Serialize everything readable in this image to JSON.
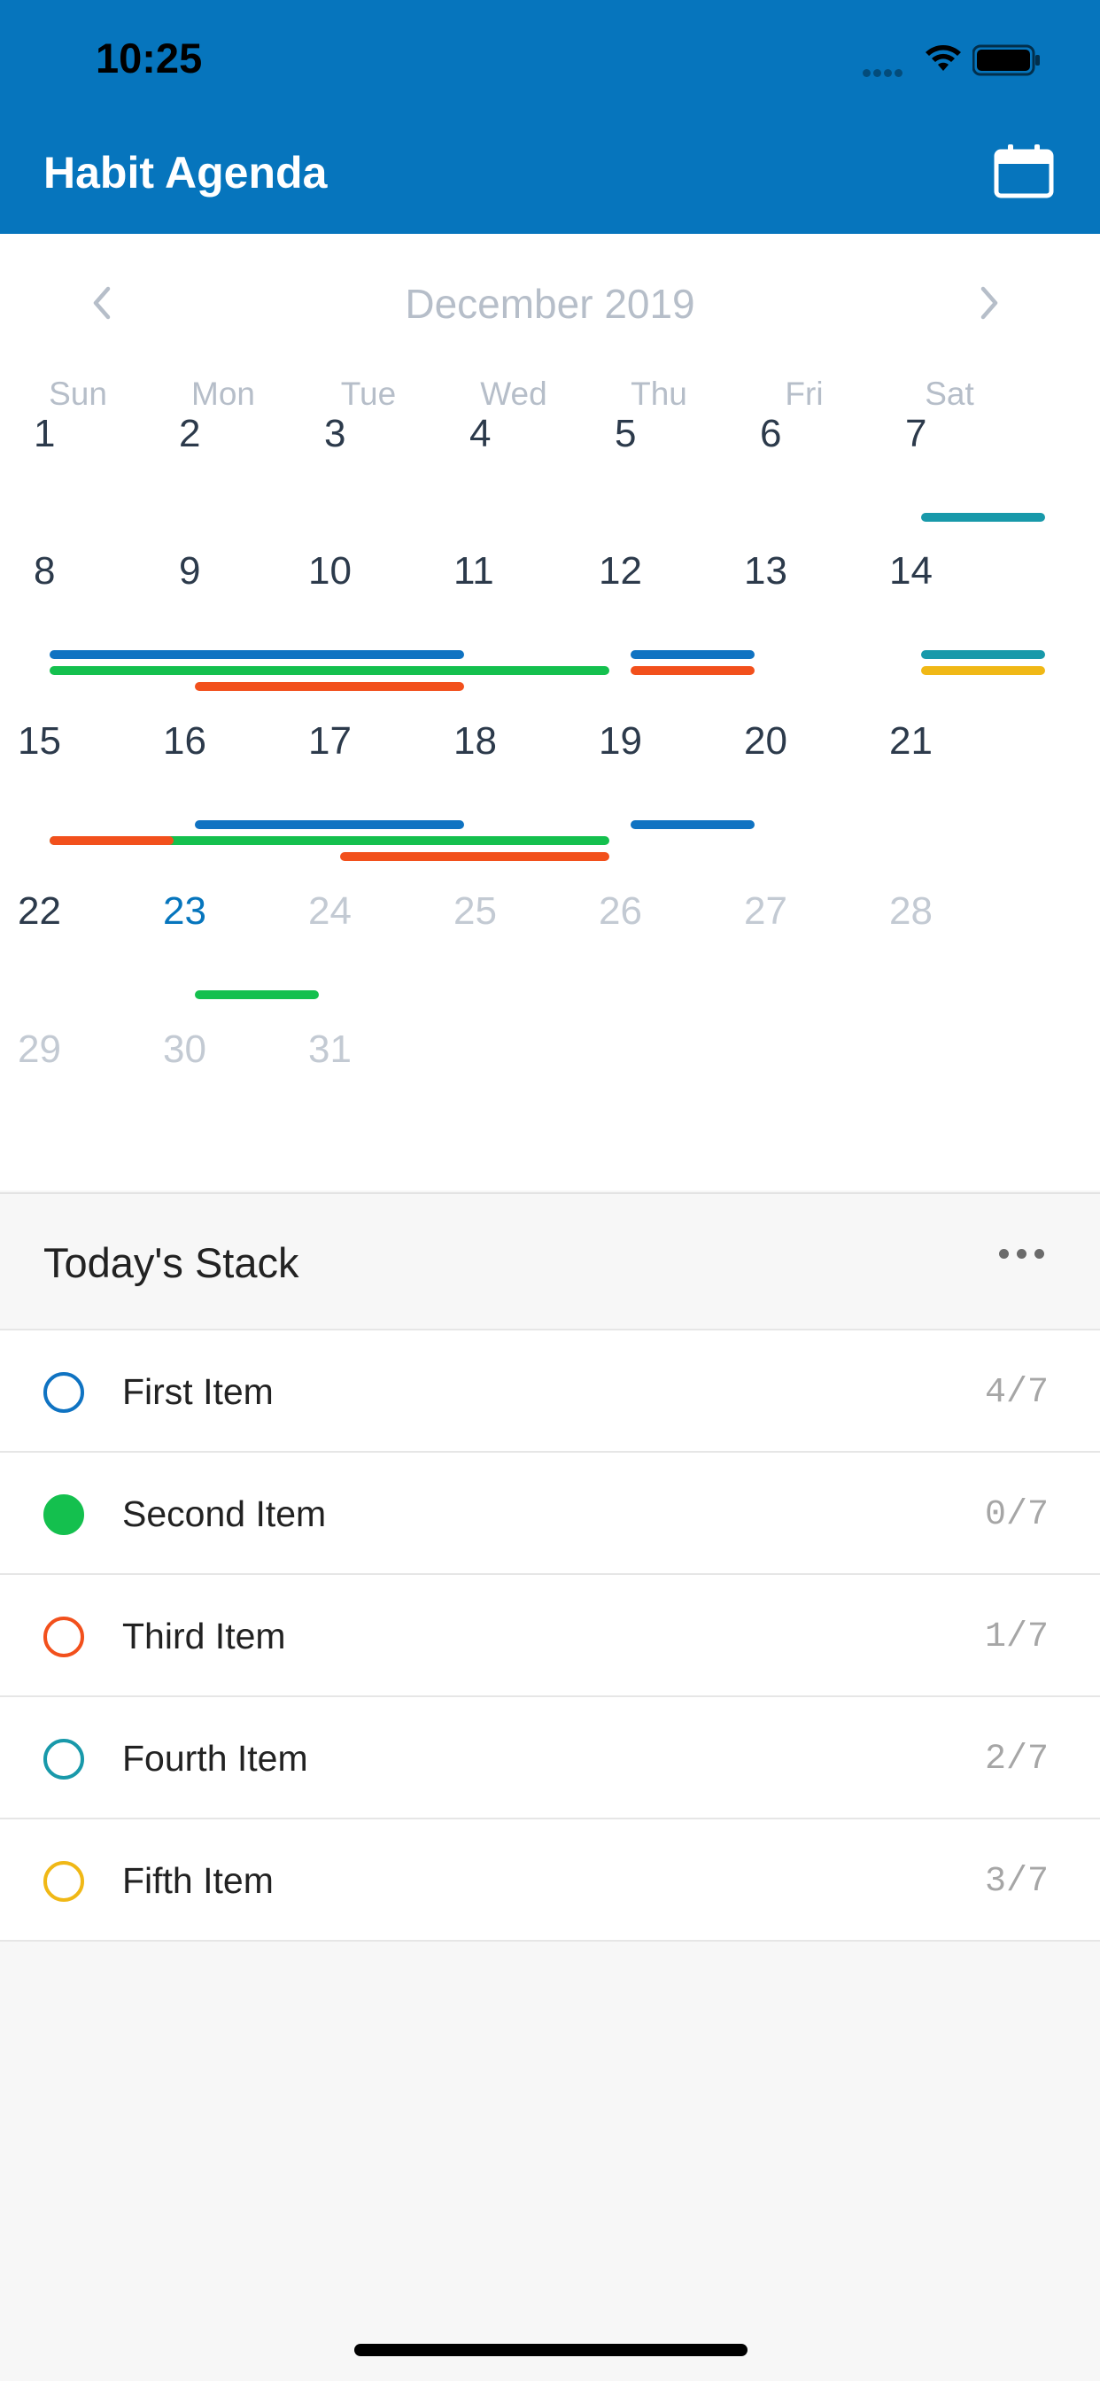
{
  "status_bar": {
    "time": "10:25",
    "icons": [
      "signal-icon",
      "wifi-icon",
      "battery-icon"
    ]
  },
  "app": {
    "title": "Habit Agenda",
    "header_color": "#0675bd",
    "calendar_icon": "calendar-icon"
  },
  "calendar": {
    "month_label": "December 2019",
    "prev_icon": "chevron-left-icon",
    "next_icon": "chevron-right-icon",
    "weekdays": [
      "Sun",
      "Mon",
      "Tue",
      "Wed",
      "Thu",
      "Fri",
      "Sat"
    ],
    "days": [
      {
        "label": "1",
        "state": "normal",
        "bars": []
      },
      {
        "label": "2",
        "state": "normal",
        "bars": []
      },
      {
        "label": "3",
        "state": "normal",
        "bars": []
      },
      {
        "label": "4",
        "state": "normal",
        "bars": []
      },
      {
        "label": "5",
        "state": "normal",
        "bars": []
      },
      {
        "label": "6",
        "state": "normal",
        "bars": []
      },
      {
        "label": "7",
        "state": "normal",
        "bars": [
          "teal"
        ]
      },
      {
        "label": "8",
        "state": "normal",
        "bars": [
          "blue",
          "green"
        ]
      },
      {
        "label": "9",
        "state": "normal",
        "bars": [
          "blue",
          "green",
          "orange"
        ]
      },
      {
        "label": "10",
        "state": "normal",
        "bars": [
          "blue",
          "green",
          "orange"
        ]
      },
      {
        "label": "11",
        "state": "normal",
        "bars": [
          "green"
        ]
      },
      {
        "label": "12",
        "state": "normal",
        "bars": [
          "blue",
          "orange"
        ]
      },
      {
        "label": "13",
        "state": "normal",
        "bars": []
      },
      {
        "label": "14",
        "state": "normal",
        "bars": [
          "teal",
          "yellow"
        ]
      },
      {
        "label": "15",
        "state": "normal",
        "bars": [
          "green",
          "orange"
        ]
      },
      {
        "label": "16",
        "state": "normal",
        "bars": [
          "blue",
          "green"
        ]
      },
      {
        "label": "17",
        "state": "normal",
        "bars": [
          "blue",
          "green",
          "orange"
        ]
      },
      {
        "label": "18",
        "state": "normal",
        "bars": [
          "green",
          "orange"
        ]
      },
      {
        "label": "19",
        "state": "normal",
        "bars": [
          "blue"
        ]
      },
      {
        "label": "20",
        "state": "normal",
        "bars": []
      },
      {
        "label": "21",
        "state": "normal",
        "bars": []
      },
      {
        "label": "22",
        "state": "normal",
        "bars": []
      },
      {
        "label": "23",
        "state": "today",
        "bars": [
          "green"
        ]
      },
      {
        "label": "24",
        "state": "inactive",
        "bars": []
      },
      {
        "label": "25",
        "state": "inactive",
        "bars": []
      },
      {
        "label": "26",
        "state": "inactive",
        "bars": []
      },
      {
        "label": "27",
        "state": "inactive",
        "bars": []
      },
      {
        "label": "28",
        "state": "inactive",
        "bars": []
      },
      {
        "label": "29",
        "state": "inactive",
        "bars": []
      },
      {
        "label": "30",
        "state": "inactive",
        "bars": []
      },
      {
        "label": "31",
        "state": "inactive",
        "bars": []
      }
    ],
    "first_weekday_index": 0
  },
  "colors": {
    "blue": "#0f73c2",
    "green": "#14c04e",
    "orange": "#f2501c",
    "teal": "#1899aa",
    "yellow": "#f0b816",
    "text_dark": "#2c3a4b",
    "text_muted": "#c3cad3",
    "today": "#0675bd"
  },
  "stack": {
    "title": "Today's Stack",
    "more_icon": "more-dots-icon",
    "items": [
      {
        "label": "First Item",
        "count": "4/7",
        "color": "blue",
        "filled": false
      },
      {
        "label": "Second Item",
        "count": "0/7",
        "color": "green",
        "filled": true
      },
      {
        "label": "Third Item",
        "count": "1/7",
        "color": "orange",
        "filled": false
      },
      {
        "label": "Fourth Item",
        "count": "2/7",
        "color": "teal",
        "filled": false
      },
      {
        "label": "Fifth Item",
        "count": "3/7",
        "color": "yellow",
        "filled": false
      }
    ]
  }
}
